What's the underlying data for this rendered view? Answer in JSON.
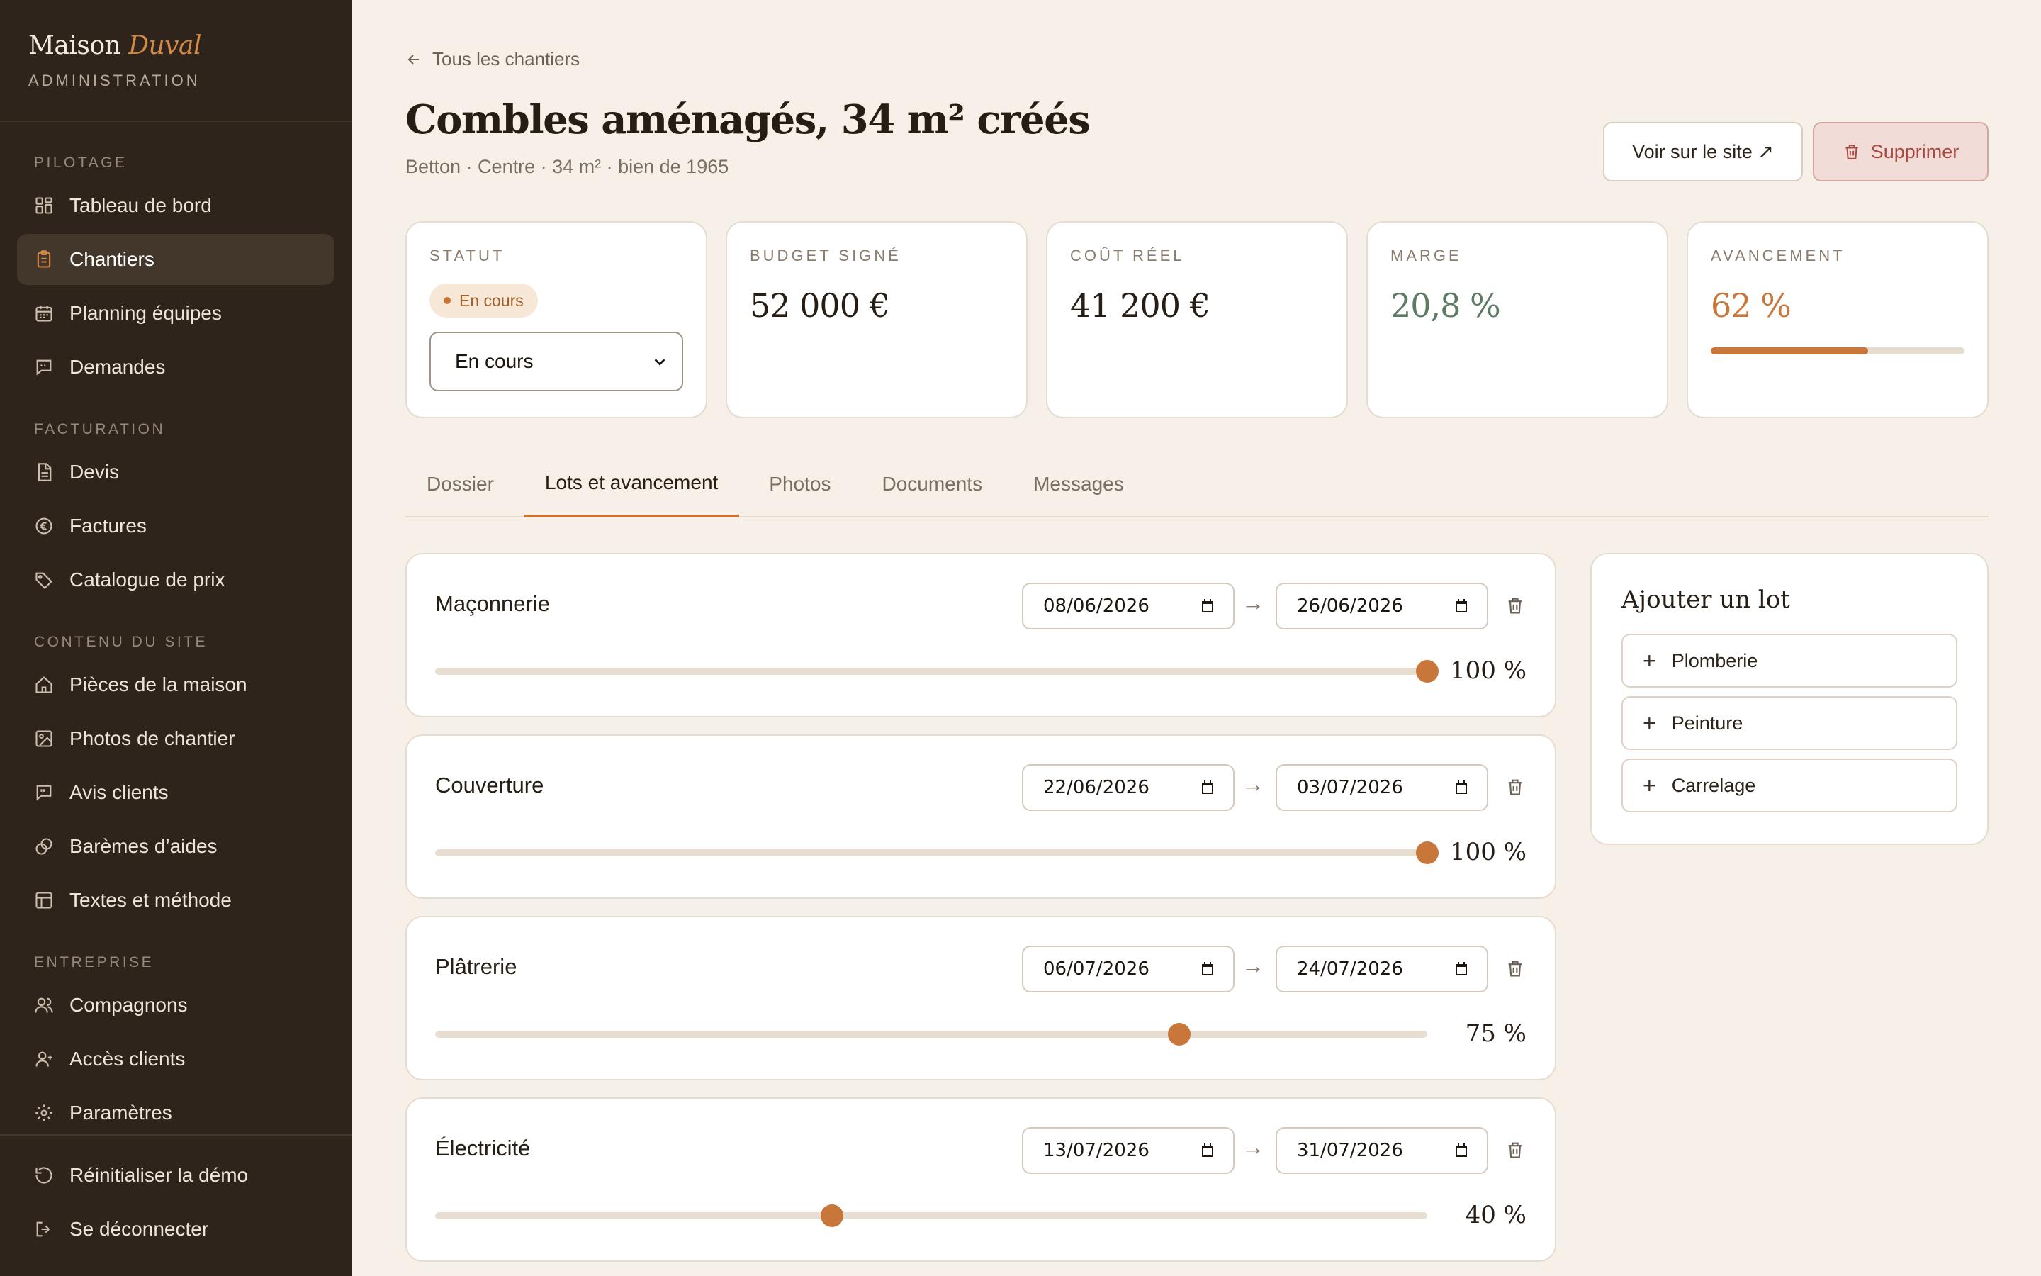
{
  "brand": {
    "name": "Maison",
    "name_accent": "Duval",
    "subtitle": "ADMINISTRATION"
  },
  "sidebar": {
    "sections": [
      {
        "label": "PILOTAGE",
        "items": [
          {
            "label": "Tableau de bord",
            "icon": "grid-icon",
            "active": false
          },
          {
            "label": "Chantiers",
            "icon": "clipboard-icon",
            "active": true
          },
          {
            "label": "Planning équipes",
            "icon": "calendar-icon",
            "active": false
          },
          {
            "label": "Demandes",
            "icon": "message-icon",
            "active": false
          }
        ]
      },
      {
        "label": "FACTURATION",
        "items": [
          {
            "label": "Devis",
            "icon": "document-icon"
          },
          {
            "label": "Factures",
            "icon": "euro-icon"
          },
          {
            "label": "Catalogue de prix",
            "icon": "tag-icon"
          }
        ]
      },
      {
        "label": "CONTENU DU SITE",
        "items": [
          {
            "label": "Pièces de la maison",
            "icon": "home-icon"
          },
          {
            "label": "Photos de chantier",
            "icon": "image-icon"
          },
          {
            "label": "Avis clients",
            "icon": "quote-icon"
          },
          {
            "label": "Barèmes d’aides",
            "icon": "coins-icon"
          },
          {
            "label": "Textes et méthode",
            "icon": "layout-icon"
          }
        ]
      },
      {
        "label": "ENTREPRISE",
        "items": [
          {
            "label": "Compagnons",
            "icon": "users-icon"
          },
          {
            "label": "Accès clients",
            "icon": "user-icon"
          },
          {
            "label": "Paramètres",
            "icon": "gear-icon"
          }
        ]
      }
    ],
    "footer": [
      {
        "label": "Réinitialiser la démo",
        "icon": "reset-icon"
      },
      {
        "label": "Se déconnecter",
        "icon": "logout-icon"
      }
    ]
  },
  "header": {
    "back_label": "Tous les chantiers",
    "title": "Combles aménagés, 34 m² créés",
    "subtitle": "Betton · Centre · 34 m² · bien de 1965",
    "view_site_label": "Voir sur le site ↗",
    "delete_label": "Supprimer"
  },
  "stats": {
    "status": {
      "label": "STATUT",
      "badge": "En cours",
      "select_value": "En cours"
    },
    "budget": {
      "label": "BUDGET SIGNÉ",
      "value": "52 000 €"
    },
    "cost": {
      "label": "COÛT RÉEL",
      "value": "41 200 €"
    },
    "margin": {
      "label": "MARGE",
      "value": "20,8 %"
    },
    "progress": {
      "label": "AVANCEMENT",
      "value": "62 %",
      "fraction": 0.62
    }
  },
  "tabs": [
    "Dossier",
    "Lots et avancement",
    "Photos",
    "Documents",
    "Messages"
  ],
  "active_tab": 1,
  "lots": [
    {
      "name": "Maçonnerie",
      "start": "08/06/2026",
      "end": "26/06/2026",
      "progress": 100,
      "progress_label": "100 %"
    },
    {
      "name": "Couverture",
      "start": "22/06/2026",
      "end": "03/07/2026",
      "progress": 100,
      "progress_label": "100 %"
    },
    {
      "name": "Plâtrerie",
      "start": "06/07/2026",
      "end": "24/07/2026",
      "progress": 75,
      "progress_label": "75 %"
    },
    {
      "name": "Électricité",
      "start": "13/07/2026",
      "end": "31/07/2026",
      "progress": 40,
      "progress_label": "40 %"
    }
  ],
  "add_lot": {
    "title": "Ajouter un lot",
    "options": [
      "Plomberie",
      "Peinture",
      "Carrelage"
    ]
  },
  "colors": {
    "accent": "#c9763a",
    "sidebar": "#2e241b",
    "background": "#f7f0e8",
    "margin_green": "#5d7a64",
    "danger": "#a94a40"
  }
}
